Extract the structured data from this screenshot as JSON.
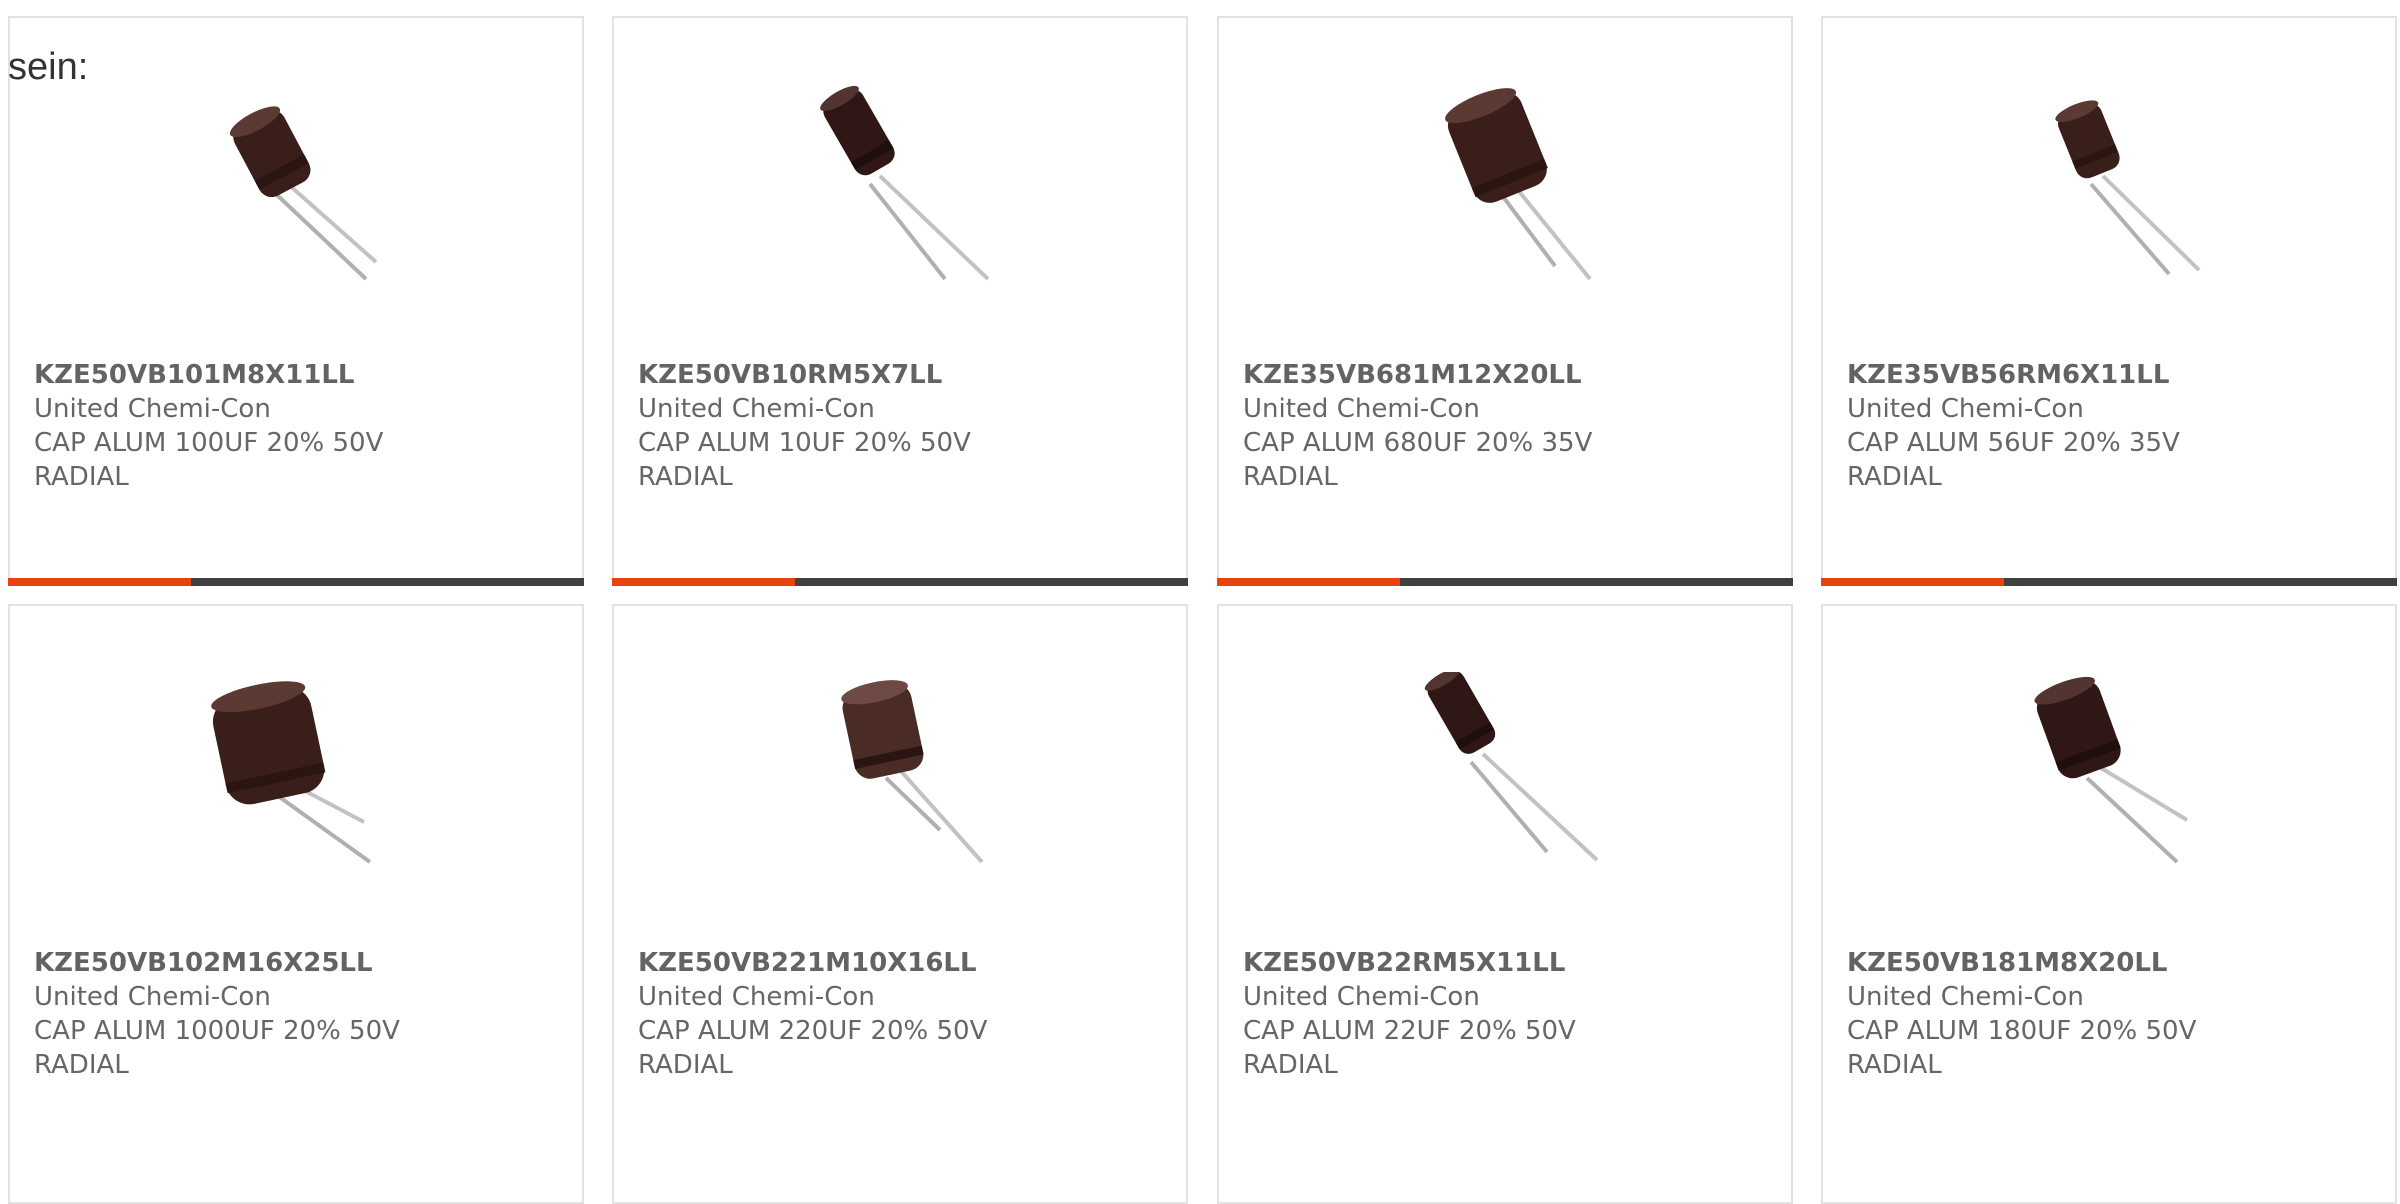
{
  "lead_text": "sein:",
  "colors": {
    "accent": "#e8420f",
    "bar": "#404040",
    "border": "#e2e2e2",
    "text": "#666666"
  },
  "products": [
    {
      "part_number": "KZE50VB101M8X11LL",
      "manufacturer": "United Chemi-Con",
      "description": "CAP ALUM 100UF 20% 50V",
      "package": "RADIAL"
    },
    {
      "part_number": "KZE50VB10RM5X7LL",
      "manufacturer": "United Chemi-Con",
      "description": "CAP ALUM 10UF 20% 50V",
      "package": "RADIAL"
    },
    {
      "part_number": "KZE35VB681M12X20LL",
      "manufacturer": "United Chemi-Con",
      "description": "CAP ALUM 680UF 20% 35V",
      "package": "RADIAL"
    },
    {
      "part_number": "KZE35VB56RM6X11LL",
      "manufacturer": "United Chemi-Con",
      "description": "CAP ALUM 56UF 20% 35V",
      "package": "RADIAL"
    },
    {
      "part_number": "KZE50VB102M16X25LL",
      "manufacturer": "United Chemi-Con",
      "description": "CAP ALUM 1000UF 20% 50V",
      "package": "RADIAL"
    },
    {
      "part_number": "KZE50VB221M10X16LL",
      "manufacturer": "United Chemi-Con",
      "description": "CAP ALUM 220UF 20% 50V",
      "package": "RADIAL"
    },
    {
      "part_number": "KZE50VB22RM5X11LL",
      "manufacturer": "United Chemi-Con",
      "description": "CAP ALUM 22UF 20% 50V",
      "package": "RADIAL"
    },
    {
      "part_number": "KZE50VB181M8X20LL",
      "manufacturer": "United Chemi-Con",
      "description": "CAP ALUM 180UF 20% 50V",
      "package": "RADIAL"
    }
  ]
}
